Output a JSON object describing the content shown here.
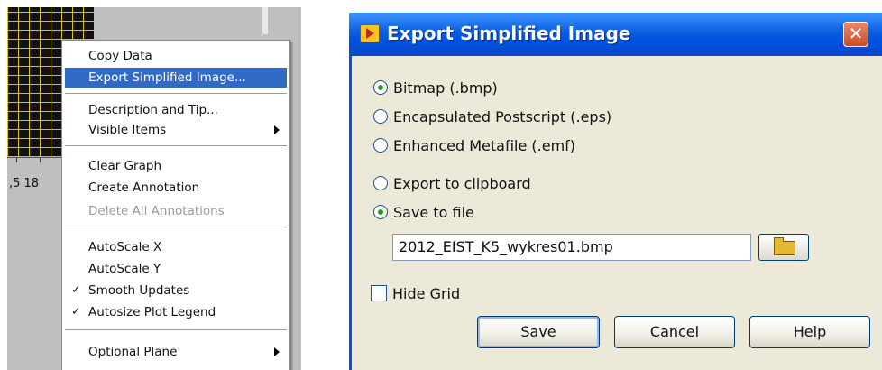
{
  "graph": {
    "tick_label": ",5  18"
  },
  "context_menu": {
    "items": [
      {
        "label": "Copy Data"
      },
      {
        "label": "Export Simplified Image...",
        "highlighted": true
      },
      {
        "label": "Description and Tip..."
      },
      {
        "label": "Visible Items",
        "submenu": true
      },
      {
        "label": "Clear Graph"
      },
      {
        "label": "Create Annotation"
      },
      {
        "label": "Delete All Annotations",
        "disabled": true
      },
      {
        "label": "AutoScale X"
      },
      {
        "label": "AutoScale Y"
      },
      {
        "label": "Smooth Updates",
        "checked": true
      },
      {
        "label": "Autosize Plot Legend",
        "checked": true
      },
      {
        "label": "Optional Plane",
        "submenu": true
      }
    ],
    "check_glyph": "✓",
    "highlight_color": "#316ac5"
  },
  "dialog": {
    "title": "Export Simplified Image",
    "close_glyph": "✕",
    "title_icon": "labview-vi-icon",
    "format_options": [
      {
        "label": "Bitmap (.bmp)",
        "selected": true
      },
      {
        "label": "Encapsulated Postscript (.eps)",
        "selected": false
      },
      {
        "label": "Enhanced Metafile (.emf)",
        "selected": false
      }
    ],
    "destination_options": [
      {
        "label": "Export to clipboard",
        "selected": false
      },
      {
        "label": "Save to file",
        "selected": true
      }
    ],
    "file_path": "2012_EIST_K5_wykres01.bmp",
    "browse_icon": "folder-open-icon",
    "hide_grid_label": "Hide Grid",
    "hide_grid_checked": false,
    "buttons": {
      "save": "Save",
      "cancel": "Cancel",
      "help": "Help"
    },
    "colors": {
      "titlebar": "#0054e3",
      "body": "#ece9d8",
      "radio_dot": "#21a121"
    }
  }
}
